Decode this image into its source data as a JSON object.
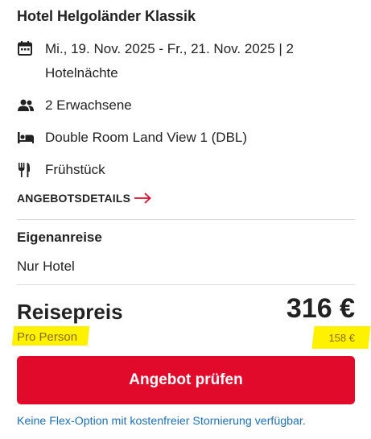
{
  "offer": {
    "hotel_name": "Hotel Helgoländer Klassik",
    "dates": "Mi., 19. Nov. 2025 - Fr., 21. Nov. 2025 | 2 Hotelnächte",
    "guests": "2 Erwachsene",
    "room": "Double Room Land View 1 (DBL)",
    "board": "Frühstück",
    "details_link": "ANGEBOTSDETAILS",
    "travel_type": "Eigenanreise",
    "package_type": "Nur Hotel"
  },
  "price": {
    "label": "Reisepreis",
    "total": "316 €",
    "per_person_label": "Pro Person",
    "per_person_value": "158 €"
  },
  "cta": {
    "label": "Angebot prüfen"
  },
  "flex_note": "Keine Flex-Option mit kostenfreier Stornierung verfügbar.",
  "icons": {
    "calendar": "calendar-icon",
    "guests": "people-icon",
    "room": "bed-icon",
    "board": "cutlery-icon",
    "arrow": "arrow-right-icon"
  },
  "colors": {
    "accent_red": "#e20a2b",
    "link_blue": "#1f6fb5",
    "highlight_yellow": "#fff200"
  }
}
